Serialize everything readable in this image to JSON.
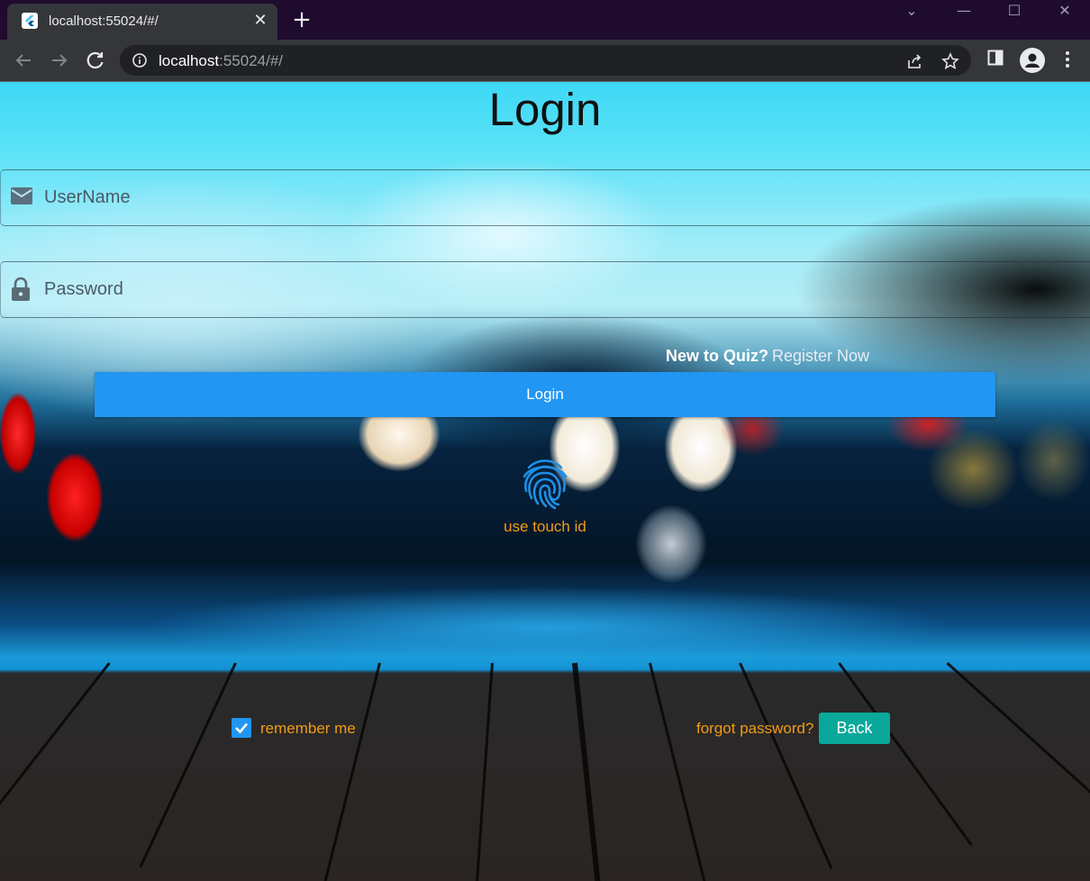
{
  "browser": {
    "tab_title": "localhost:55024/#/",
    "tab_close": "✕",
    "new_tab": "+",
    "url_host": "localhost",
    "url_rest": ":55024/#/",
    "window_controls": {
      "minimize": "—",
      "maximize": "☐",
      "close": "✕",
      "dropdown": "⌄"
    }
  },
  "page": {
    "title": "Login",
    "username": {
      "placeholder": "UserName",
      "icon": "mail-icon"
    },
    "password": {
      "placeholder": "Password",
      "icon": "lock-icon"
    },
    "new_to_quiz": "New to Quiz?",
    "register_now": "Register Now",
    "login_button": "Login",
    "touch_id": "use touch id",
    "remember_me": {
      "label": "remember me",
      "checked": true
    },
    "forgot_password": "forgot password?",
    "back_button": "Back"
  },
  "colors": {
    "primary": "#2196f3",
    "accent_orange": "#f29c12",
    "back_teal": "#0aa89a",
    "browser_frame": "#1f0b2d"
  }
}
